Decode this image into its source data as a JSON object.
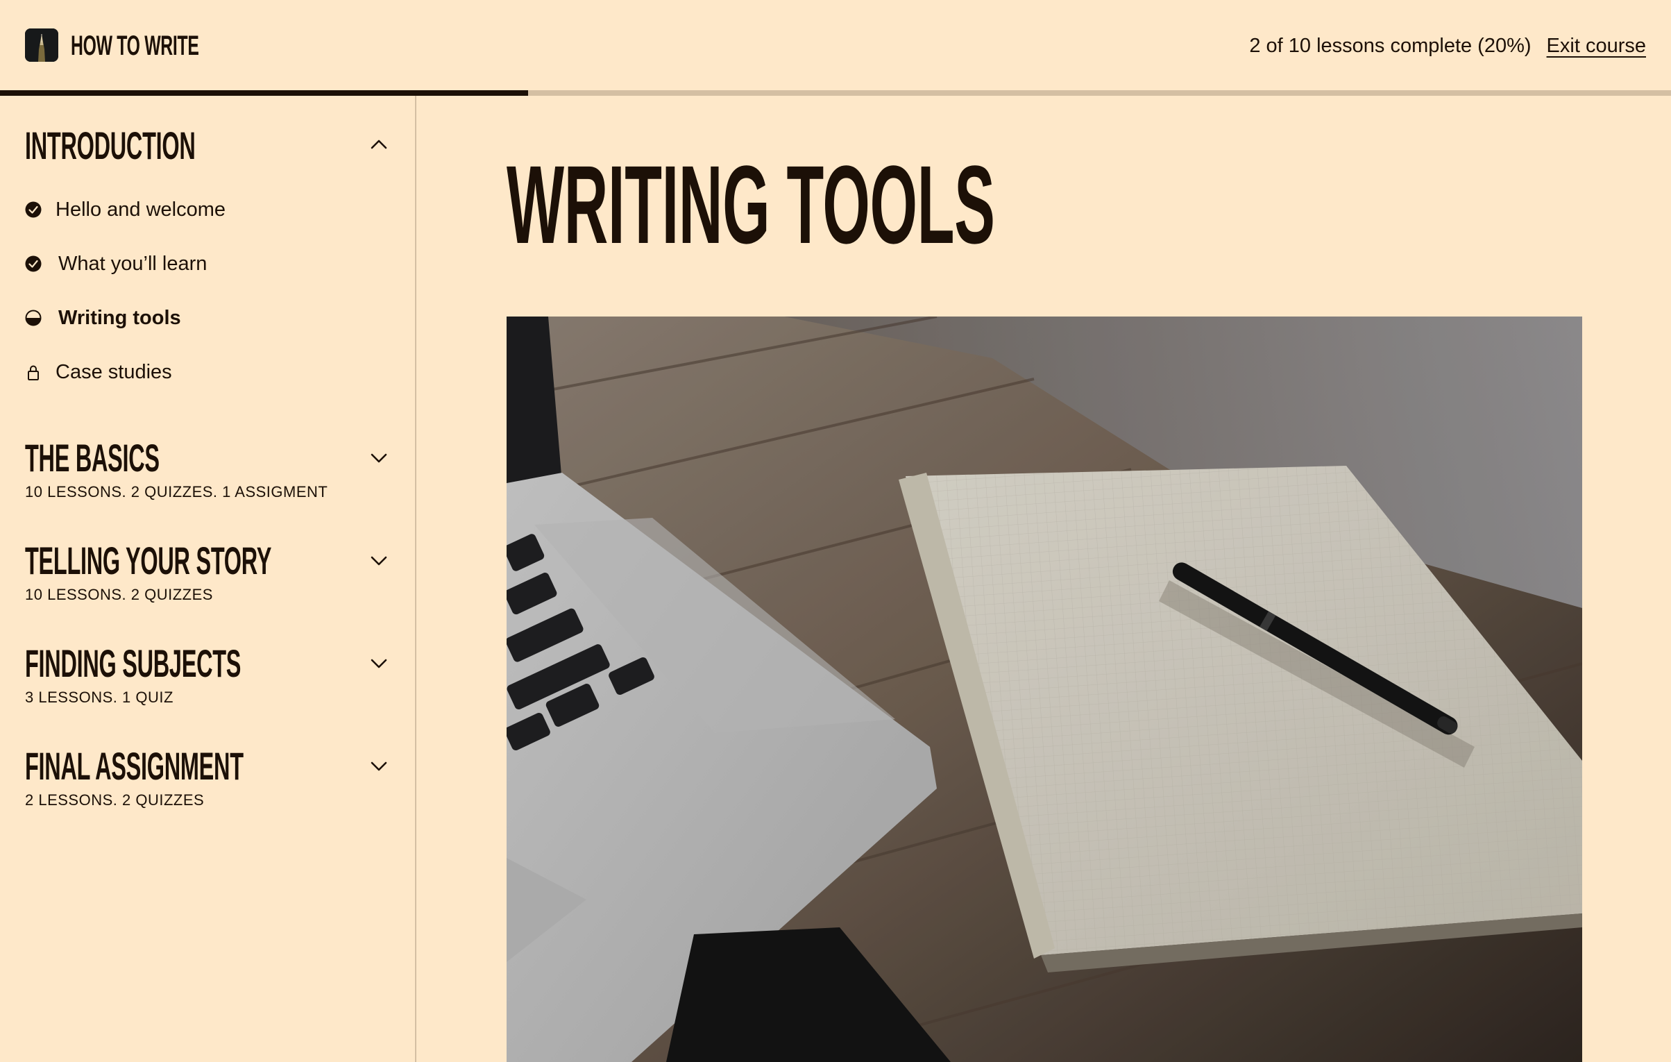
{
  "header": {
    "brand": "HOW TO WRITE",
    "logo_icon": "pencil-tip-icon",
    "progress_text": "2 of 10 lessons complete (20%)",
    "exit_label": "Exit course"
  },
  "progress": {
    "lessons_complete": 2,
    "lessons_total": 10,
    "percent_label": 20,
    "bar_fill_fraction": 0.316
  },
  "sidebar": {
    "sections": [
      {
        "title": "INTRODUCTION",
        "expanded": true,
        "toggle_icon": "chevron-up-icon",
        "lessons": [
          {
            "label": "Hello and welcome",
            "status": "complete",
            "icon": "check-circle-icon"
          },
          {
            "label": "What you’ll learn",
            "status": "complete",
            "icon": "check-circle-icon"
          },
          {
            "label": "Writing tools",
            "status": "in-progress",
            "icon": "half-circle-icon"
          },
          {
            "label": "Case studies",
            "status": "locked",
            "icon": "lock-icon"
          }
        ]
      },
      {
        "title": "THE BASICS",
        "meta": "10 LESSONS. 2 QUIZZES. 1 ASSIGMENT",
        "expanded": false,
        "toggle_icon": "chevron-down-icon"
      },
      {
        "title": "TELLING YOUR STORY",
        "meta": "10 LESSONS. 2 QUIZZES",
        "expanded": false,
        "toggle_icon": "chevron-down-icon"
      },
      {
        "title": "FINDING SUBJECTS",
        "meta": "3 LESSONS. 1 QUIZ",
        "expanded": false,
        "toggle_icon": "chevron-down-icon"
      },
      {
        "title": "FINAL ASSIGNMENT",
        "meta": "2 LESSONS. 2 QUIZZES",
        "expanded": false,
        "toggle_icon": "chevron-down-icon"
      }
    ]
  },
  "main": {
    "title": "WRITING TOOLS",
    "hero_image": "laptop-notebook-pen-on-wooden-table"
  },
  "colors": {
    "background": "#fee8c9",
    "text": "#1c1007",
    "progress_track": "#d4bfa3",
    "divider": "#d4bfa3"
  }
}
